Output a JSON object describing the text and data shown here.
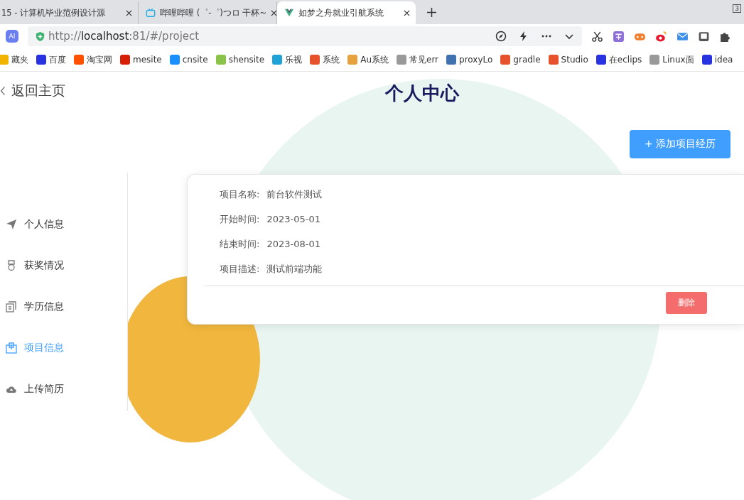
{
  "browser": {
    "tabs": [
      {
        "title": "15 - 计算机毕业范例设计源",
        "selected": false
      },
      {
        "title": "哔哩哔哩 (゜-゜)つロ 干杯~",
        "selected": false
      },
      {
        "title": "如梦之舟就业引航系统",
        "selected": true
      }
    ],
    "ai_badge": "AI",
    "tab_count": "3",
    "url_prefix": "http://",
    "url_host": "localhost",
    "url_rest": ":81/#/project",
    "bookmarks": [
      {
        "label": "藏夹",
        "color": "#f0b400"
      },
      {
        "label": "百度",
        "color": "#2932e1"
      },
      {
        "label": "淘宝网",
        "color": "#ff5000"
      },
      {
        "label": "mesite",
        "color": "#d81e06"
      },
      {
        "label": "cnsite",
        "color": "#1890ff"
      },
      {
        "label": "shensite",
        "color": "#8bc34a"
      },
      {
        "label": "乐视",
        "color": "#1fa2d6"
      },
      {
        "label": "系统",
        "color": "#e6522c"
      },
      {
        "label": "Au系统",
        "color": "#e6a23c"
      },
      {
        "label": "常见err",
        "color": "#999999"
      },
      {
        "label": "proxyLo",
        "color": "#3f72af"
      },
      {
        "label": "gradle",
        "color": "#e6522c"
      },
      {
        "label": "Studio",
        "color": "#e6522c"
      },
      {
        "label": "在eclips",
        "color": "#2932e1"
      },
      {
        "label": "Linux面",
        "color": "#999999"
      },
      {
        "label": "idea",
        "color": "#2932e1"
      }
    ]
  },
  "page": {
    "back_link": "返回主页",
    "title": "个人中心",
    "add_button": "+ 添加项目经历",
    "menu": [
      {
        "label": "个人信息",
        "selected": false
      },
      {
        "label": "获奖情况",
        "selected": false
      },
      {
        "label": "学历信息",
        "selected": false
      },
      {
        "label": "项目信息",
        "selected": true
      },
      {
        "label": "上传简历",
        "selected": false
      }
    ],
    "projects": [
      {
        "fields": [
          {
            "label": "项目名称:",
            "value": "前台软件测试"
          },
          {
            "label": "开始时间:",
            "value": "2023-05-01"
          },
          {
            "label": "结束时间:",
            "value": "2023-08-01"
          },
          {
            "label": "项目描述:",
            "value": "测试前端功能"
          }
        ],
        "delete_button": "删除"
      }
    ]
  }
}
